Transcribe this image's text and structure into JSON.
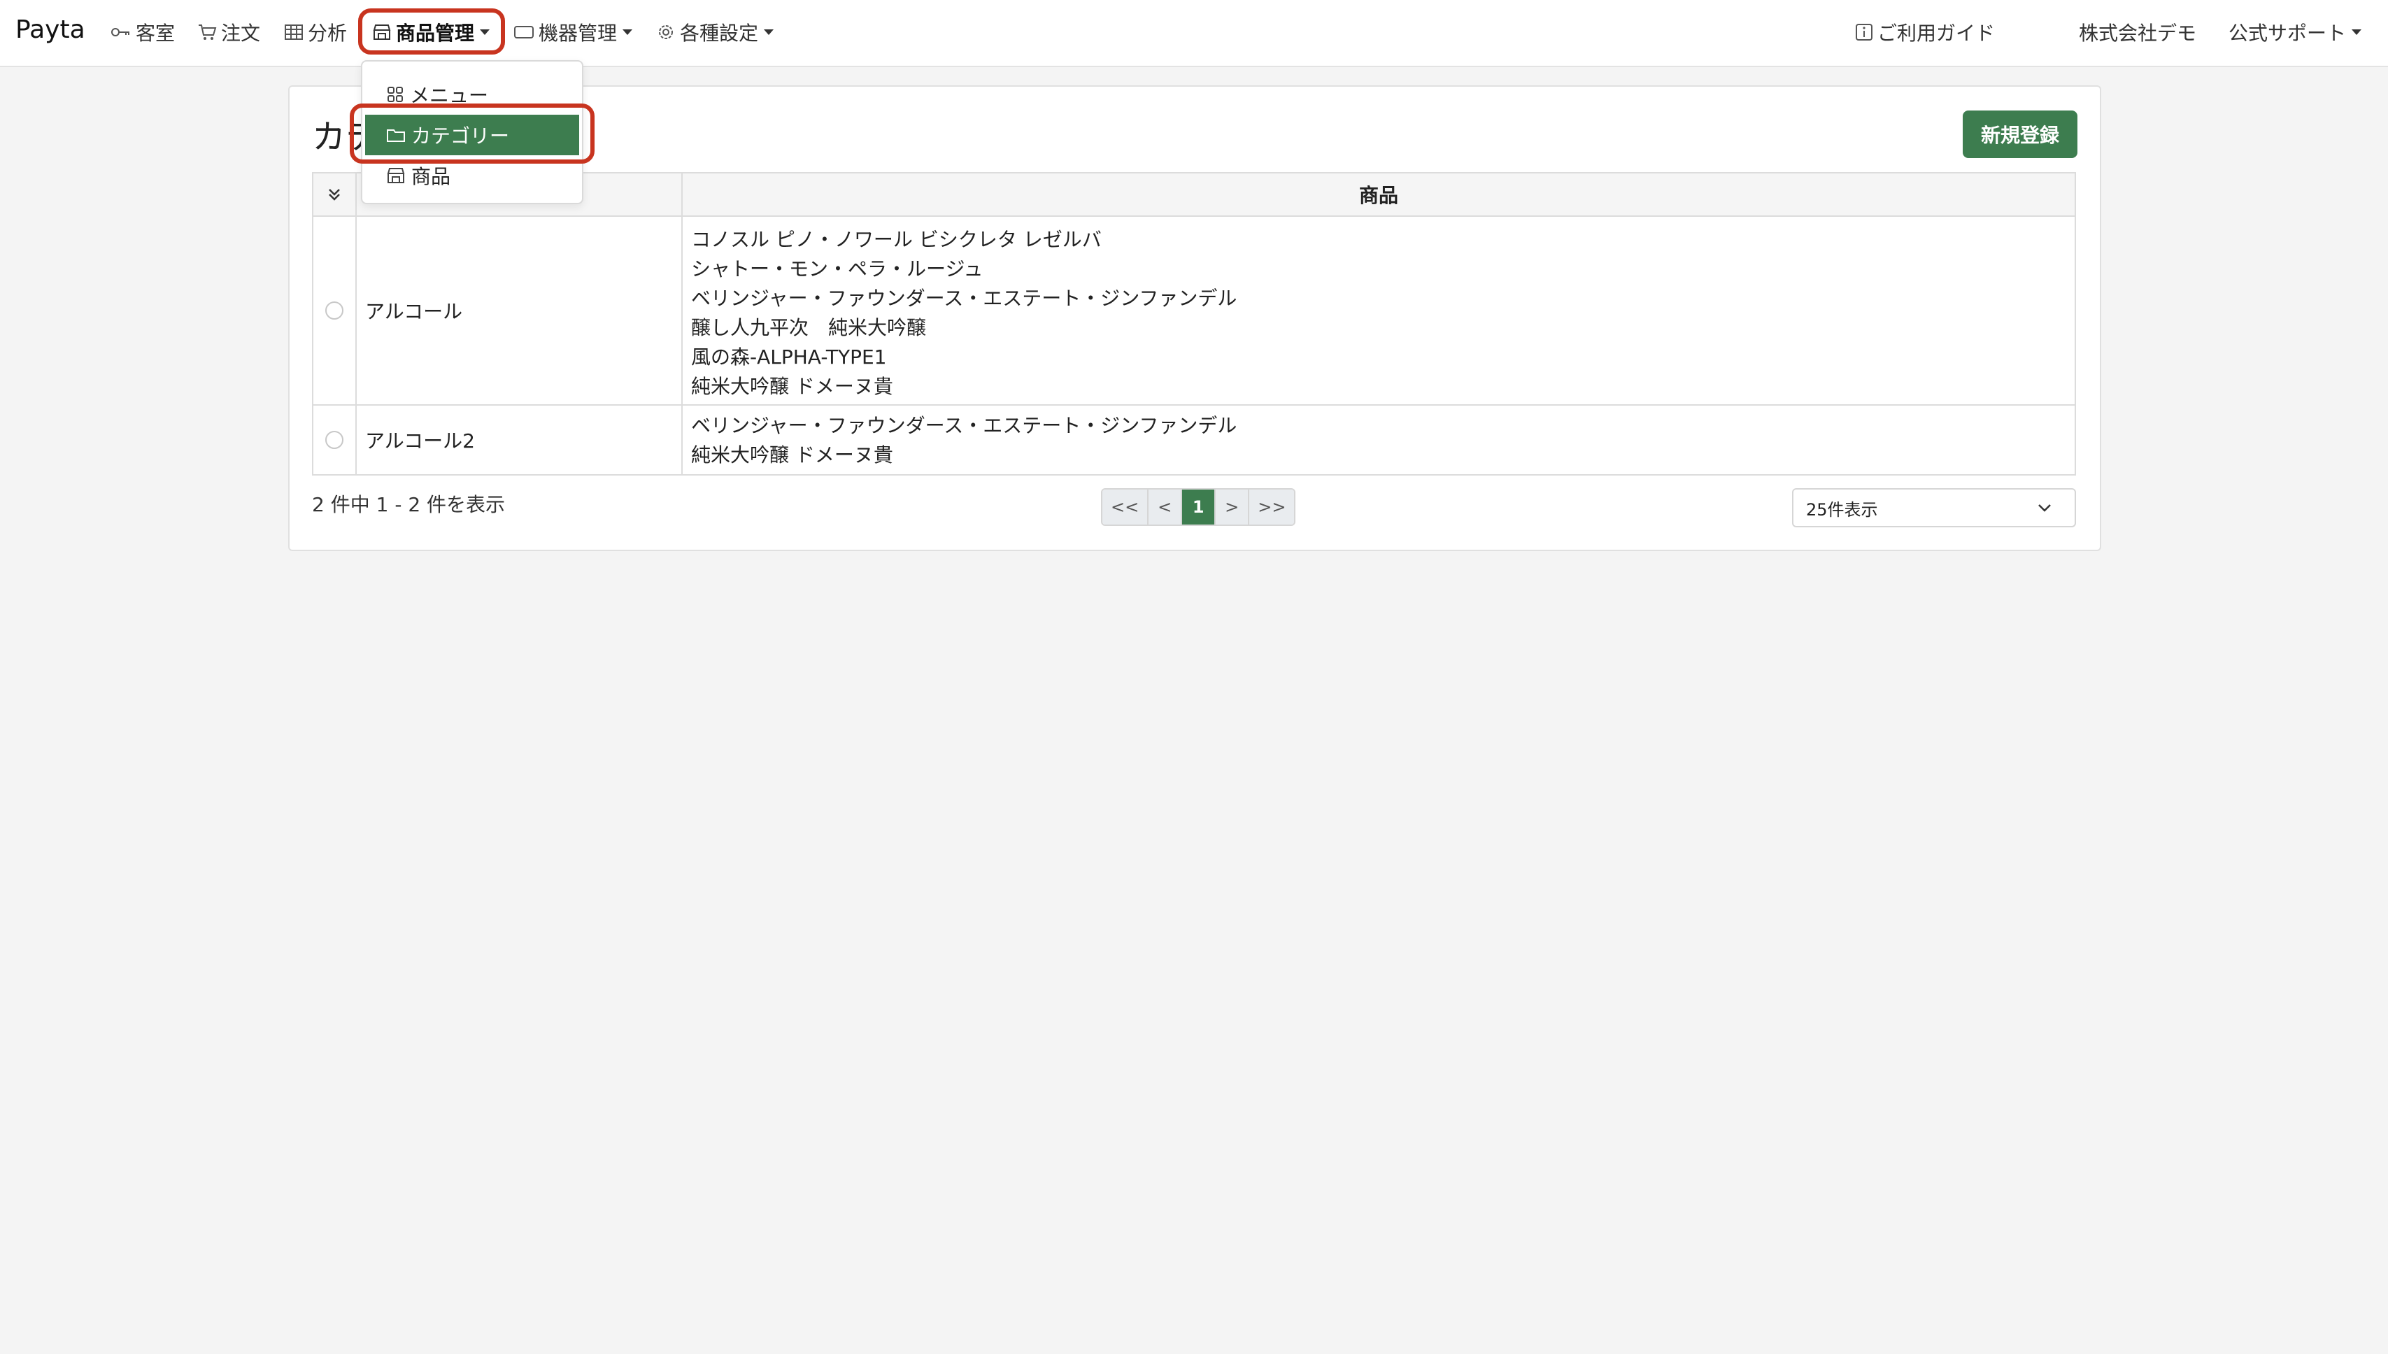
{
  "navbar": {
    "brand": "Payta",
    "items": [
      {
        "label": "客室",
        "icon": "key-icon"
      },
      {
        "label": "注文",
        "icon": "cart-icon"
      },
      {
        "label": "分析",
        "icon": "table-icon"
      },
      {
        "label": "商品管理",
        "icon": "shop-icon"
      },
      {
        "label": "機器管理",
        "icon": "device-icon"
      },
      {
        "label": "各種設定",
        "icon": "gear-icon"
      }
    ],
    "guide": "ご利用ガイド",
    "company": "株式会社デモ",
    "support": "公式サポート"
  },
  "dropdown": {
    "items": [
      {
        "label": "メニュー",
        "icon": "grid-icon"
      },
      {
        "label": "カテゴリー",
        "icon": "folder-icon"
      },
      {
        "label": "商品",
        "icon": "shop-icon"
      }
    ]
  },
  "page": {
    "title": "カテゴリー",
    "new_button": "新規登録"
  },
  "table": {
    "header_product": "商品",
    "rows": [
      {
        "name": "アルコール",
        "products": [
          "コノスル ピノ・ノワール ビシクレタ レゼルバ",
          "シャトー・モン・ペラ・ルージュ",
          "ベリンジャー・ファウンダース・エステート・ジンファンデル",
          "醸し人九平次　純米大吟醸",
          "風の森-ALPHA-TYPE1",
          "純米大吟醸 ドメーヌ貴"
        ]
      },
      {
        "name": "アルコール2",
        "products": [
          "ベリンジャー・ファウンダース・エステート・ジンファンデル",
          "純米大吟醸 ドメーヌ貴"
        ]
      }
    ]
  },
  "pagination": {
    "info": "2 件中 1 - 2 件を表示",
    "first": "<<",
    "prev": "<",
    "current": "1",
    "next": ">",
    "last": ">>",
    "per_page": "25件表示"
  },
  "colors": {
    "accent": "#3d7d4f",
    "highlight": "#c8341f"
  }
}
